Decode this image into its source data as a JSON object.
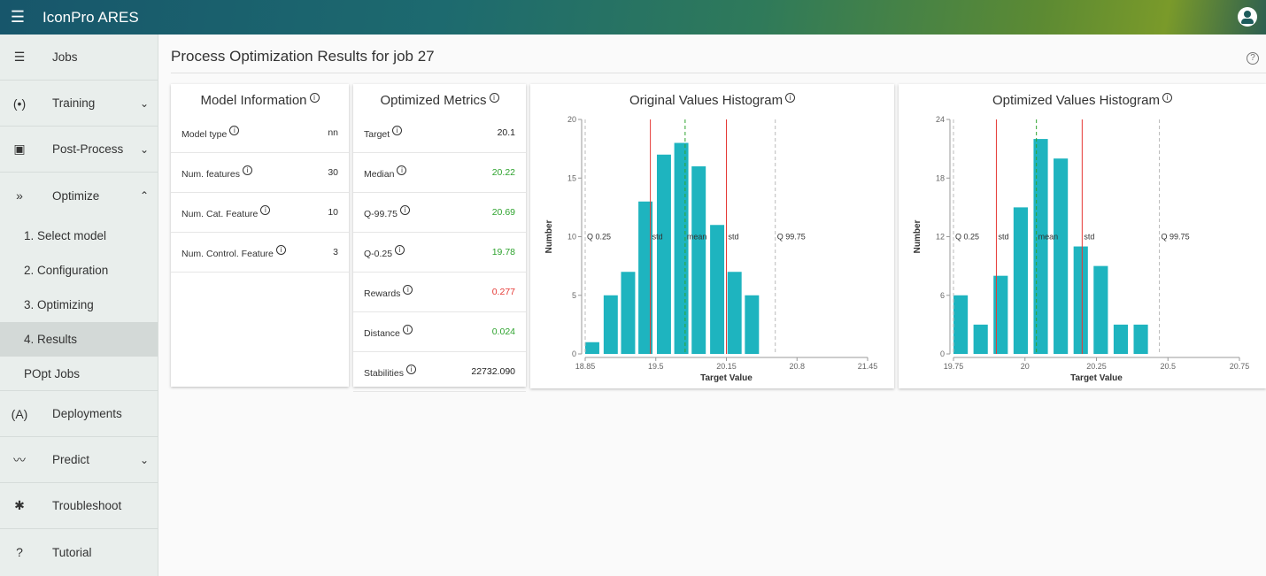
{
  "app": {
    "title": "IconPro ARES"
  },
  "sidebar": {
    "items": [
      {
        "label": "Jobs",
        "icon": "list-icon"
      },
      {
        "label": "Training",
        "icon": "training-icon",
        "chevron": "down"
      },
      {
        "label": "Post-Process",
        "icon": "chart-icon",
        "chevron": "down"
      },
      {
        "label": "Optimize",
        "icon": "double-chevron-icon",
        "chevron": "up"
      }
    ],
    "optimize_sub": [
      {
        "label": "1. Select model"
      },
      {
        "label": "2. Configuration"
      },
      {
        "label": "3. Optimizing"
      },
      {
        "label": "4. Results",
        "active": true
      }
    ],
    "popt_jobs": "POpt Jobs",
    "bottom_items": [
      {
        "label": "Deployments",
        "icon": "antenna-icon"
      },
      {
        "label": "Predict",
        "icon": "trend-icon",
        "chevron": "down"
      },
      {
        "label": "Troubleshoot",
        "icon": "bug-icon"
      },
      {
        "label": "Tutorial",
        "icon": "help-circle-icon"
      }
    ]
  },
  "page": {
    "title": "Process Optimization Results for job 27"
  },
  "model_info": {
    "title": "Model Information",
    "rows": [
      {
        "label": "Model type",
        "value": "nn"
      },
      {
        "label": "Num. features",
        "value": "30"
      },
      {
        "label": "Num. Cat. Feature",
        "value": "10"
      },
      {
        "label": "Num. Control. Feature",
        "value": "3"
      }
    ]
  },
  "optimized_metrics": {
    "title": "Optimized Metrics",
    "rows": [
      {
        "label": "Target",
        "value": "20.1",
        "color": "#222222"
      },
      {
        "label": "Median",
        "value": "20.22",
        "color": "#2ea32e"
      },
      {
        "label": "Q-99.75",
        "value": "20.69",
        "color": "#2ea32e"
      },
      {
        "label": "Q-0.25",
        "value": "19.78",
        "color": "#2ea32e"
      },
      {
        "label": "Rewards",
        "value": "0.277",
        "color": "#e53935"
      },
      {
        "label": "Distance",
        "value": "0.024",
        "color": "#2ea32e"
      },
      {
        "label": "Stabilities",
        "value": "22732.090",
        "color": "#222222"
      }
    ]
  },
  "chart_data": [
    {
      "type": "bar",
      "title": "Original Values Histogram",
      "xlabel": "Target Value",
      "ylabel": "Number",
      "xlim": [
        18.85,
        21.45
      ],
      "ylim": [
        0,
        20
      ],
      "x_ticks": [
        "18.85",
        "19.5",
        "20.15",
        "20.8",
        "21.45"
      ],
      "y_ticks": [
        "0",
        "5",
        "10",
        "15",
        "20"
      ],
      "bar_color": "#1eb4bf",
      "bins": [
        {
          "x0": 18.85,
          "x1": 18.98,
          "value": 1
        },
        {
          "x0": 19.02,
          "x1": 19.15,
          "value": 5
        },
        {
          "x0": 19.18,
          "x1": 19.31,
          "value": 7
        },
        {
          "x0": 19.34,
          "x1": 19.47,
          "value": 13
        },
        {
          "x0": 19.51,
          "x1": 19.64,
          "value": 17
        },
        {
          "x0": 19.67,
          "x1": 19.8,
          "value": 18
        },
        {
          "x0": 19.83,
          "x1": 19.96,
          "value": 16
        },
        {
          "x0": 20.0,
          "x1": 20.13,
          "value": 11
        },
        {
          "x0": 20.16,
          "x1": 20.29,
          "value": 7
        },
        {
          "x0": 20.32,
          "x1": 20.45,
          "value": 5
        }
      ],
      "reference_lines": [
        {
          "label": "Q 0.25",
          "x": 18.85,
          "color": "#bbbbbb",
          "style": "dashed"
        },
        {
          "label": "std",
          "x": 19.45,
          "color": "#e53935",
          "style": "solid"
        },
        {
          "label": "mean",
          "x": 19.77,
          "color": "#2ea32e",
          "style": "dashed"
        },
        {
          "label": "std",
          "x": 20.15,
          "color": "#e53935",
          "style": "solid"
        },
        {
          "label": "Q 99.75",
          "x": 20.6,
          "color": "#bbbbbb",
          "style": "dashed"
        }
      ]
    },
    {
      "type": "bar",
      "title": "Optimized Values Histogram",
      "xlabel": "Target Value",
      "ylabel": "Number",
      "xlim": [
        19.75,
        20.75
      ],
      "ylim": [
        0,
        24
      ],
      "x_ticks": [
        "19.75",
        "20",
        "20.25",
        "20.5",
        "20.75"
      ],
      "y_ticks": [
        "0",
        "6",
        "12",
        "18",
        "24"
      ],
      "bar_color": "#1eb4bf",
      "bins": [
        {
          "x0": 19.75,
          "x1": 19.8,
          "value": 6
        },
        {
          "x0": 19.82,
          "x1": 19.87,
          "value": 3
        },
        {
          "x0": 19.89,
          "x1": 19.94,
          "value": 8
        },
        {
          "x0": 19.96,
          "x1": 20.01,
          "value": 15
        },
        {
          "x0": 20.03,
          "x1": 20.08,
          "value": 22
        },
        {
          "x0": 20.1,
          "x1": 20.15,
          "value": 20
        },
        {
          "x0": 20.17,
          "x1": 20.22,
          "value": 11
        },
        {
          "x0": 20.24,
          "x1": 20.29,
          "value": 9
        },
        {
          "x0": 20.31,
          "x1": 20.36,
          "value": 3
        },
        {
          "x0": 20.38,
          "x1": 20.43,
          "value": 3
        }
      ],
      "reference_lines": [
        {
          "label": "Q 0.25",
          "x": 19.75,
          "color": "#bbbbbb",
          "style": "dashed"
        },
        {
          "label": "std",
          "x": 19.9,
          "color": "#e53935",
          "style": "solid"
        },
        {
          "label": "mean",
          "x": 20.04,
          "color": "#2ea32e",
          "style": "dashed"
        },
        {
          "label": "std",
          "x": 20.2,
          "color": "#e53935",
          "style": "solid"
        },
        {
          "label": "Q 99.75",
          "x": 20.47,
          "color": "#bbbbbb",
          "style": "dashed"
        }
      ]
    }
  ]
}
